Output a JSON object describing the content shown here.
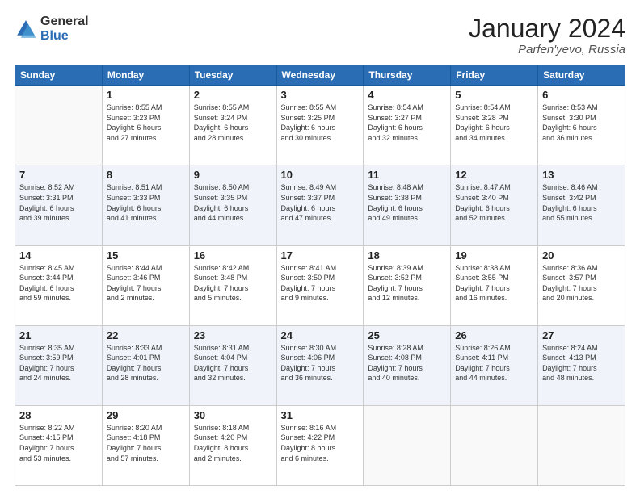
{
  "header": {
    "logo_general": "General",
    "logo_blue": "Blue",
    "title": "January 2024",
    "location": "Parfen'yevo, Russia"
  },
  "weekdays": [
    "Sunday",
    "Monday",
    "Tuesday",
    "Wednesday",
    "Thursday",
    "Friday",
    "Saturday"
  ],
  "weeks": [
    [
      {
        "day": "",
        "info": ""
      },
      {
        "day": "1",
        "info": "Sunrise: 8:55 AM\nSunset: 3:23 PM\nDaylight: 6 hours\nand 27 minutes."
      },
      {
        "day": "2",
        "info": "Sunrise: 8:55 AM\nSunset: 3:24 PM\nDaylight: 6 hours\nand 28 minutes."
      },
      {
        "day": "3",
        "info": "Sunrise: 8:55 AM\nSunset: 3:25 PM\nDaylight: 6 hours\nand 30 minutes."
      },
      {
        "day": "4",
        "info": "Sunrise: 8:54 AM\nSunset: 3:27 PM\nDaylight: 6 hours\nand 32 minutes."
      },
      {
        "day": "5",
        "info": "Sunrise: 8:54 AM\nSunset: 3:28 PM\nDaylight: 6 hours\nand 34 minutes."
      },
      {
        "day": "6",
        "info": "Sunrise: 8:53 AM\nSunset: 3:30 PM\nDaylight: 6 hours\nand 36 minutes."
      }
    ],
    [
      {
        "day": "7",
        "info": "Sunrise: 8:52 AM\nSunset: 3:31 PM\nDaylight: 6 hours\nand 39 minutes."
      },
      {
        "day": "8",
        "info": "Sunrise: 8:51 AM\nSunset: 3:33 PM\nDaylight: 6 hours\nand 41 minutes."
      },
      {
        "day": "9",
        "info": "Sunrise: 8:50 AM\nSunset: 3:35 PM\nDaylight: 6 hours\nand 44 minutes."
      },
      {
        "day": "10",
        "info": "Sunrise: 8:49 AM\nSunset: 3:37 PM\nDaylight: 6 hours\nand 47 minutes."
      },
      {
        "day": "11",
        "info": "Sunrise: 8:48 AM\nSunset: 3:38 PM\nDaylight: 6 hours\nand 49 minutes."
      },
      {
        "day": "12",
        "info": "Sunrise: 8:47 AM\nSunset: 3:40 PM\nDaylight: 6 hours\nand 52 minutes."
      },
      {
        "day": "13",
        "info": "Sunrise: 8:46 AM\nSunset: 3:42 PM\nDaylight: 6 hours\nand 55 minutes."
      }
    ],
    [
      {
        "day": "14",
        "info": "Sunrise: 8:45 AM\nSunset: 3:44 PM\nDaylight: 6 hours\nand 59 minutes."
      },
      {
        "day": "15",
        "info": "Sunrise: 8:44 AM\nSunset: 3:46 PM\nDaylight: 7 hours\nand 2 minutes."
      },
      {
        "day": "16",
        "info": "Sunrise: 8:42 AM\nSunset: 3:48 PM\nDaylight: 7 hours\nand 5 minutes."
      },
      {
        "day": "17",
        "info": "Sunrise: 8:41 AM\nSunset: 3:50 PM\nDaylight: 7 hours\nand 9 minutes."
      },
      {
        "day": "18",
        "info": "Sunrise: 8:39 AM\nSunset: 3:52 PM\nDaylight: 7 hours\nand 12 minutes."
      },
      {
        "day": "19",
        "info": "Sunrise: 8:38 AM\nSunset: 3:55 PM\nDaylight: 7 hours\nand 16 minutes."
      },
      {
        "day": "20",
        "info": "Sunrise: 8:36 AM\nSunset: 3:57 PM\nDaylight: 7 hours\nand 20 minutes."
      }
    ],
    [
      {
        "day": "21",
        "info": "Sunrise: 8:35 AM\nSunset: 3:59 PM\nDaylight: 7 hours\nand 24 minutes."
      },
      {
        "day": "22",
        "info": "Sunrise: 8:33 AM\nSunset: 4:01 PM\nDaylight: 7 hours\nand 28 minutes."
      },
      {
        "day": "23",
        "info": "Sunrise: 8:31 AM\nSunset: 4:04 PM\nDaylight: 7 hours\nand 32 minutes."
      },
      {
        "day": "24",
        "info": "Sunrise: 8:30 AM\nSunset: 4:06 PM\nDaylight: 7 hours\nand 36 minutes."
      },
      {
        "day": "25",
        "info": "Sunrise: 8:28 AM\nSunset: 4:08 PM\nDaylight: 7 hours\nand 40 minutes."
      },
      {
        "day": "26",
        "info": "Sunrise: 8:26 AM\nSunset: 4:11 PM\nDaylight: 7 hours\nand 44 minutes."
      },
      {
        "day": "27",
        "info": "Sunrise: 8:24 AM\nSunset: 4:13 PM\nDaylight: 7 hours\nand 48 minutes."
      }
    ],
    [
      {
        "day": "28",
        "info": "Sunrise: 8:22 AM\nSunset: 4:15 PM\nDaylight: 7 hours\nand 53 minutes."
      },
      {
        "day": "29",
        "info": "Sunrise: 8:20 AM\nSunset: 4:18 PM\nDaylight: 7 hours\nand 57 minutes."
      },
      {
        "day": "30",
        "info": "Sunrise: 8:18 AM\nSunset: 4:20 PM\nDaylight: 8 hours\nand 2 minutes."
      },
      {
        "day": "31",
        "info": "Sunrise: 8:16 AM\nSunset: 4:22 PM\nDaylight: 8 hours\nand 6 minutes."
      },
      {
        "day": "",
        "info": ""
      },
      {
        "day": "",
        "info": ""
      },
      {
        "day": "",
        "info": ""
      }
    ]
  ]
}
